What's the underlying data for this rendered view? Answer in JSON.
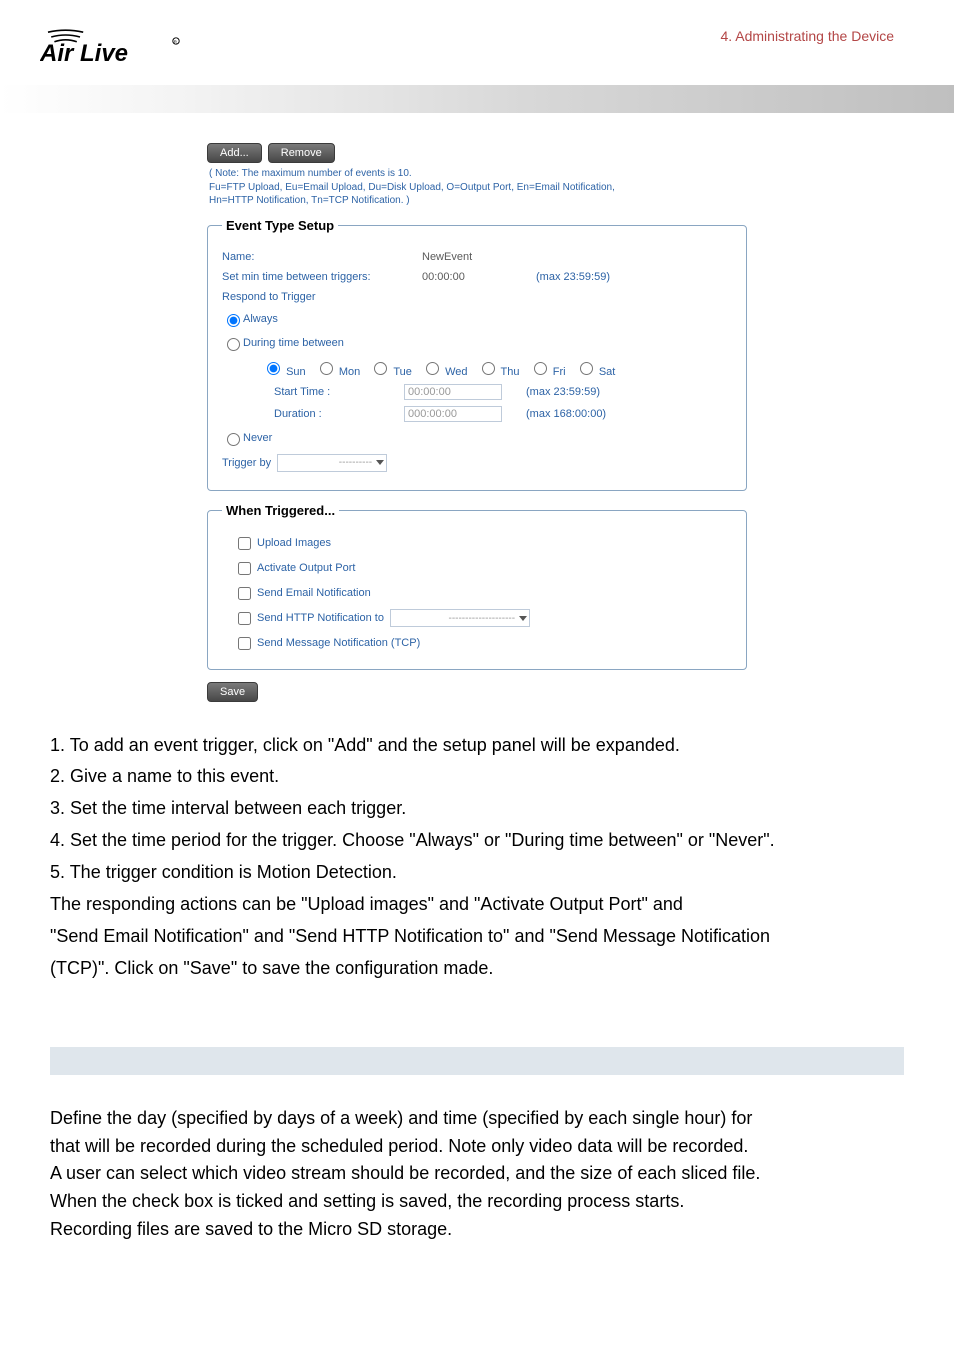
{
  "header": {
    "logo_text": "Air Live",
    "right_text": "4.  Administrating  the  Device"
  },
  "form": {
    "buttons": {
      "add": "Add...",
      "remove": "Remove",
      "save": "Save"
    },
    "note_line1": "( Note: The maximum number of events is 10.",
    "note_line2": "  Fu=FTP Upload, Eu=Email Upload, Du=Disk Upload, O=Output Port, En=Email Notification,",
    "note_line3": "Hn=HTTP Notification, Tn=TCP Notification. )",
    "event_type": {
      "legend": "Event Type Setup",
      "name_label": "Name:",
      "name_value": "NewEvent",
      "mintime_label": "Set min time between triggers:",
      "mintime_value": "00:00:00",
      "mintime_max": "(max 23:59:59)",
      "respond_label": "Respond to Trigger",
      "always_label": "Always",
      "during_label": "During time between",
      "days": [
        "Sun",
        "Mon",
        "Tue",
        "Wed",
        "Thu",
        "Fri",
        "Sat"
      ],
      "start_label": "Start Time :",
      "start_value": "00:00:00",
      "start_max": "(max 23:59:59)",
      "duration_label": "Duration :",
      "duration_value": "000:00:00",
      "duration_max": "(max 168:00:00)",
      "never_label": "Never",
      "trigger_by_label": "Trigger by",
      "trigger_by_value": "----------"
    },
    "when_triggered": {
      "legend": "When Triggered...",
      "upload": "Upload Images",
      "activate": "Activate Output Port",
      "email": "Send Email Notification",
      "http": "Send HTTP Notification to",
      "http_select": "--------------------",
      "tcp": "Send Message Notification (TCP)"
    }
  },
  "body_lines": {
    "l1": "1. To add an event trigger, click on \"Add\" and the setup panel will be expanded.",
    "l2": "2. Give a name to this event.",
    "l3": "3. Set the time interval between each trigger.",
    "l4": "4. Set the time period for the trigger. Choose \"Always\" or \"During time between\" or \"Never\".",
    "l5": "5. The trigger condition is Motion Detection.",
    "l6": "The responding actions can be \"Upload images\" and \"Activate Output Port\" and",
    "l7": "\"Send Email Notification\" and \"Send HTTP Notification to\" and \"Send Message Notification",
    "l8": "(TCP)\".    Click on \"Save\" to save the configuration made."
  },
  "lower_lines": {
    "p1": "Define the day (specified by days of a week) and time (specified by each single hour) for",
    "p2": "that will be recorded during the scheduled period.    Note only video data will be recorded.",
    "p3": "A user can select which video stream should be recorded, and the size of each sliced file.",
    "p4": "When the check box is ticked and setting is saved, the recording process starts.",
    "p5": "Recording files are saved to the Micro SD storage."
  }
}
